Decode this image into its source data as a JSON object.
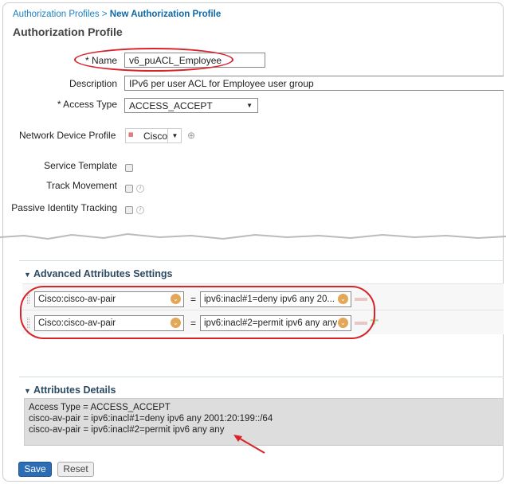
{
  "breadcrumb": {
    "parent": "Authorization Profiles",
    "separator": " > ",
    "current": "New Authorization Profile"
  },
  "title": "Authorization Profile",
  "form": {
    "name_label": "* Name",
    "name_value": "v6_puACL_Employee",
    "description_label": "Description",
    "description_value": "IPv6 per user ACL for Employee user group",
    "access_type_label": "* Access Type",
    "access_type_value": "ACCESS_ACCEPT",
    "ndp_label": "Network Device Profile",
    "ndp_value": "Cisco",
    "service_template_label": "Service Template",
    "track_movement_label": "Track Movement",
    "passive_identity_label": "Passive Identity Tracking"
  },
  "advanced": {
    "header": "Advanced Attributes Settings",
    "rows": [
      {
        "attribute": "Cisco:cisco-av-pair",
        "operator": "=",
        "value": "ipv6:inacl#1=deny ipv6 any 20..."
      },
      {
        "attribute": "Cisco:cisco-av-pair",
        "operator": "=",
        "value": "ipv6:inacl#2=permit ipv6 any any"
      }
    ]
  },
  "details": {
    "header": "Attributes Details",
    "lines": [
      "Access Type = ACCESS_ACCEPT",
      "cisco-av-pair = ipv6:inacl#1=deny ipv6 any 2001:20:199::/64",
      "cisco-av-pair = ipv6:inacl#2=permit ipv6 any any"
    ]
  },
  "buttons": {
    "save": "Save",
    "reset": "Reset"
  },
  "colors": {
    "highlight": "#d9222a",
    "link": "#1a7fc0",
    "save": "#2d6db5"
  }
}
